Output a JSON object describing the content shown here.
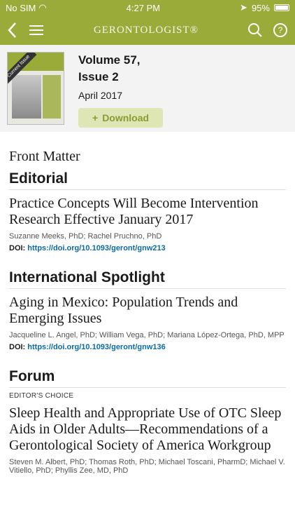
{
  "status": {
    "carrier": "No SIM",
    "time": "4:27 PM",
    "battery": "95%"
  },
  "nav": {
    "title": "GERONTOLOGIST®",
    "icons": [
      "back-icon",
      "menu-icon",
      "search-icon",
      "help-icon"
    ]
  },
  "issue": {
    "cover_label": "Current Issue",
    "volume": "Volume 57,",
    "issue": "Issue 2",
    "date": "April 2017",
    "download": "Download"
  },
  "sections": [
    {
      "label": "Front Matter"
    },
    {
      "title": "Editorial",
      "article": {
        "title": "Practice Concepts Will Become Intervention Research Effective January 2017",
        "authors": "Suzanne Meeks, PhD; Rachel Pruchno, PhD",
        "doi_label": "DOI:",
        "doi": "https://doi.org/10.1093/geront/gnw213"
      }
    },
    {
      "title": "International Spotlight",
      "article": {
        "title": "Aging in Mexico: Population Trends and Emerging Issues",
        "authors": "Jacqueline L. Angel, PhD; William Vega, PhD; Mariana López-Ortega, PhD, MPP",
        "doi_label": "DOI:",
        "doi": "https://doi.org/10.1093/geront/gnw136"
      }
    },
    {
      "title": "Forum",
      "tag": "EDITOR'S CHOICE",
      "article": {
        "title": "Sleep Health and Appropriate Use of OTC Sleep Aids in Older Adults—Recommendations of a Gerontological Society of America Workgroup",
        "authors": "Steven M. Albert, PhD; Thomas Roth, PhD; Michael Toscani, PharmD; Michael V. Vitiello, PhD; Phyllis Zee, MD, PhD"
      }
    }
  ],
  "colors": {
    "accent": "#9aab3a",
    "link": "#0a6aa8"
  }
}
